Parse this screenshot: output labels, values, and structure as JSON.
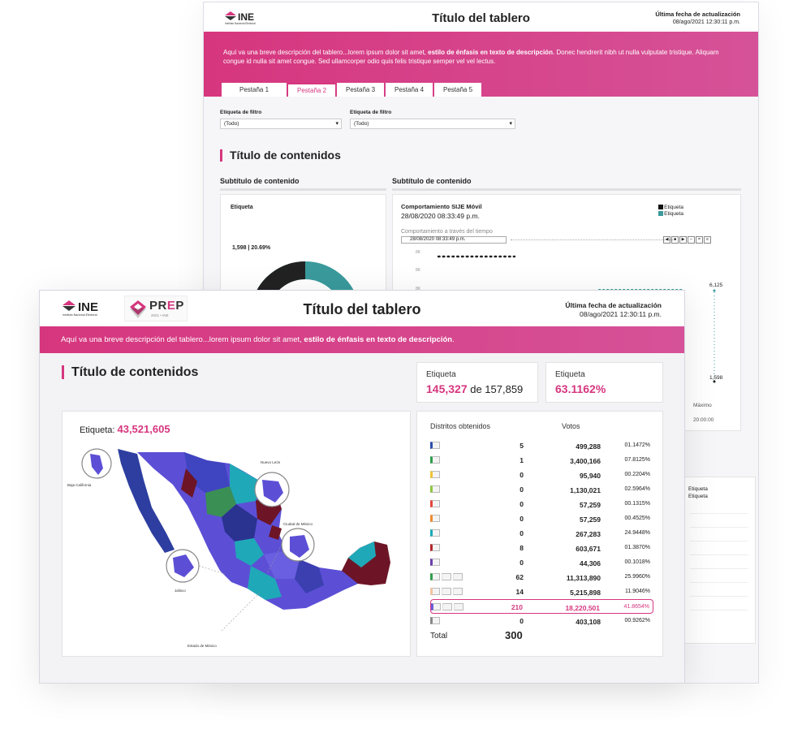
{
  "back": {
    "header": {
      "org_name": "Instituto Nacional Electoral",
      "title": "Título del tablero",
      "updated_label": "Última fecha de actualización",
      "updated_value": "08/ago/2021 12:30:11 p.m."
    },
    "description_plain": "Aquí va una breve descripción del tablero...lorem ipsum dolor sit amet, ",
    "description_emphasis": "estilo de énfasis en texto de descripción",
    "description_rest": ". Donec hendrerit nibh ut nulla vulputate tristique. Aliquam congue id nulla sit amet congue. Sed ullamcorper odio quis felis tristique semper vel vel lectus.",
    "tabs": [
      "Pestaña 1",
      "Pestaña 2",
      "Pestaña 3",
      "Pestaña 4",
      "Pestaña 5"
    ],
    "active_tab": "Pestaña 2",
    "filters": [
      {
        "label": "Etiqueta de filtro",
        "value": "(Todo)"
      },
      {
        "label": "Etiqueta de filtro",
        "value": "(Todo)"
      }
    ],
    "section_title": "Título de contenidos",
    "subtitle_left": "Subtítulo de contenido",
    "subtitle_right": "Subtítulo de contenido",
    "donut_card": {
      "label": "Etiqueta",
      "value_label": "1,598 | 20.69%"
    },
    "line_card": {
      "title": "Comportamiento SIJE Móvil",
      "date": "28/08/2020 08:33:49 p.m.",
      "legend": [
        "Etiqueta",
        "Etiqueta"
      ],
      "over_time": "Comportamiento a través del tiempo",
      "slider_value": "28/08/2020 08:33:49 p.m.",
      "y_ticks": [
        "8K",
        "8K",
        "8K"
      ],
      "point_label_1": "6,125",
      "point_label_2": "1,598",
      "max_label": "Máximo",
      "time_label": "20:00:00"
    },
    "side_card_legend": [
      "Etiqueta",
      "Etiqueta"
    ]
  },
  "front": {
    "header": {
      "ine_text": "INE",
      "org_name": "Instituto Nacional Electoral",
      "prep_pre": "PR",
      "prep_e": "E",
      "prep_post": "P",
      "prep_sub": "2021 • INE",
      "title": "Título del tablero",
      "updated_label": "Última fecha de actualización",
      "updated_value": "08/ago/2021 12:30:11 p.m."
    },
    "description_plain": "Aquí va una breve descripción del tablero...lorem ipsum dolor sit amet, ",
    "description_emphasis": "estilo de énfasis en texto de descripción",
    "description_end": ".",
    "section_title": "Título de contenidos",
    "kpi1": {
      "label": "Etiqueta",
      "value": "145,327",
      "of": " de ",
      "total": "157,859"
    },
    "kpi2": {
      "label": "Etiqueta",
      "value": "63.1162%"
    },
    "map": {
      "label": "Etiqueta: ",
      "value": "43,521,605",
      "callouts": [
        "Baja California",
        "Nuevo León",
        "Ciudad de México",
        "Jalisco",
        "Estado de México"
      ]
    },
    "table": {
      "col_districts": "Distritos obtenidos",
      "col_votes": "Votos",
      "rows": [
        {
          "colors": [
            "#2c4ea8"
          ],
          "n": "5",
          "votes": "499,288",
          "pct": "01.1472%"
        },
        {
          "colors": [
            "#2f9e4c"
          ],
          "n": "1",
          "votes": "3,400,166",
          "pct": "07.8125%"
        },
        {
          "colors": [
            "#f0c23a"
          ],
          "n": "0",
          "votes": "95,940",
          "pct": "00.2204%"
        },
        {
          "colors": [
            "#8fc743"
          ],
          "n": "0",
          "votes": "1,130,021",
          "pct": "02.5964%"
        },
        {
          "colors": [
            "#e3463c"
          ],
          "n": "0",
          "votes": "57,259",
          "pct": "00.1315%"
        },
        {
          "colors": [
            "#f08c2d"
          ],
          "n": "0",
          "votes": "57,259",
          "pct": "00.4525%"
        },
        {
          "colors": [
            "#1aa9b8"
          ],
          "n": "0",
          "votes": "267,283",
          "pct": "24.9448%"
        },
        {
          "colors": [
            "#b02a2a"
          ],
          "n": "8",
          "votes": "603,671",
          "pct": "01.3870%"
        },
        {
          "colors": [
            "#6a3fa8"
          ],
          "n": "0",
          "votes": "44,306",
          "pct": "00.1018%"
        },
        {
          "colors": [
            "#2f9e4c",
            "#dddddd",
            "#dddddd"
          ],
          "n": "62",
          "votes": "11,313,890",
          "pct": "25.9960%"
        },
        {
          "colors": [
            "#f3c6a0",
            "#dddddd",
            "#dddddd"
          ],
          "n": "14",
          "votes": "5,215,898",
          "pct": "11.9046%"
        },
        {
          "colors": [
            "#6a5fd8",
            "#dddddd",
            "#dddddd"
          ],
          "n": "210",
          "votes": "18,220,501",
          "pct": "41.8654%",
          "highlight": true
        },
        {
          "colors": [
            "#888888"
          ],
          "n": "0",
          "votes": "403,108",
          "pct": "00.9262%"
        }
      ],
      "total_label": "Total",
      "total_value": "300"
    }
  },
  "colors": {
    "brand": "#d6367e",
    "accent_band": "#d65298"
  }
}
